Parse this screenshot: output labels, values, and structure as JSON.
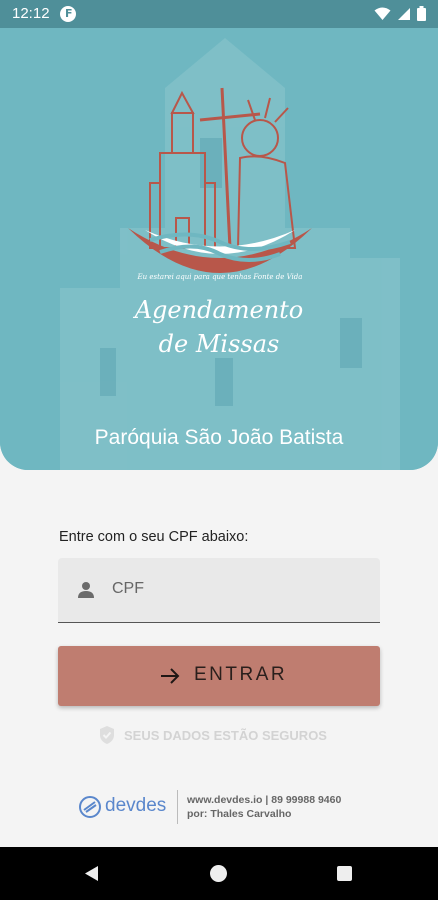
{
  "status_bar": {
    "time": "12:12",
    "app_icon_letter": "F",
    "icons": [
      "wifi-icon",
      "signal-icon",
      "battery-icon"
    ]
  },
  "hero": {
    "logo_motto": "Eu estarei aqui para que tenhas Fonte de Vida",
    "app_title_line1": "Agendamento",
    "app_title_line2": "de Missas",
    "parish_name": "Paróquia São João Batista"
  },
  "login": {
    "cpf_label": "Entre com o seu CPF abaixo:",
    "cpf_placeholder": "CPF",
    "enter_label": "ENTRAR",
    "secure_note": "SEUS DADOS ESTÃO SEGUROS"
  },
  "footer": {
    "brand": "devdes",
    "contact_line1": "www.devdes.io | 89 99988 9460",
    "contact_line2": "por: Thales Carvalho"
  },
  "colors": {
    "hero_bg": "#6fb7c1",
    "status_bar": "#4f8f99",
    "button": "#bf7d70",
    "brand_blue": "#5a87cc"
  }
}
